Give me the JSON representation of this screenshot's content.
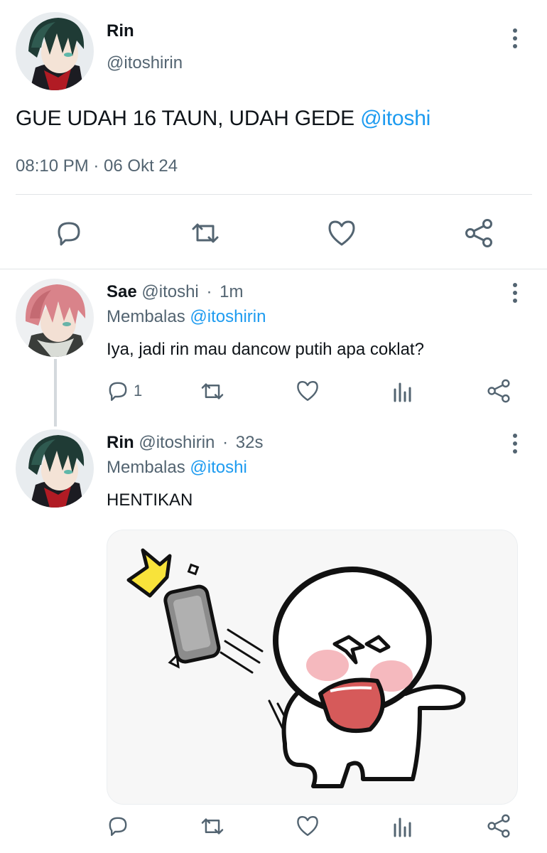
{
  "main_tweet": {
    "name": "Rin",
    "handle": "@itoshirin",
    "text": "GUE UDAH 16 TAUN, UDAH GEDE",
    "mention": "@itoshi",
    "timestamp": "08:10 PM · 06 Okt 24",
    "actions": [
      "reply-icon",
      "retweet-icon",
      "like-icon",
      "share-icon"
    ]
  },
  "replies": [
    {
      "name": "Sae",
      "handle": "@itoshi",
      "separator": "·",
      "time": "1m",
      "replying_prefix": "Membalas",
      "replying_to": "@itoshirin",
      "text": "Iya, jadi rin mau dancow putih apa coklat?",
      "reply_count": "1"
    },
    {
      "name": "Rin",
      "handle": "@itoshirin",
      "separator": "·",
      "time": "32s",
      "replying_prefix": "Membalas",
      "replying_to": "@itoshi",
      "text": "HENTIKAN"
    }
  ],
  "colors": {
    "accent": "#1d9bf0",
    "muted": "#536471",
    "text": "#0f1419"
  }
}
